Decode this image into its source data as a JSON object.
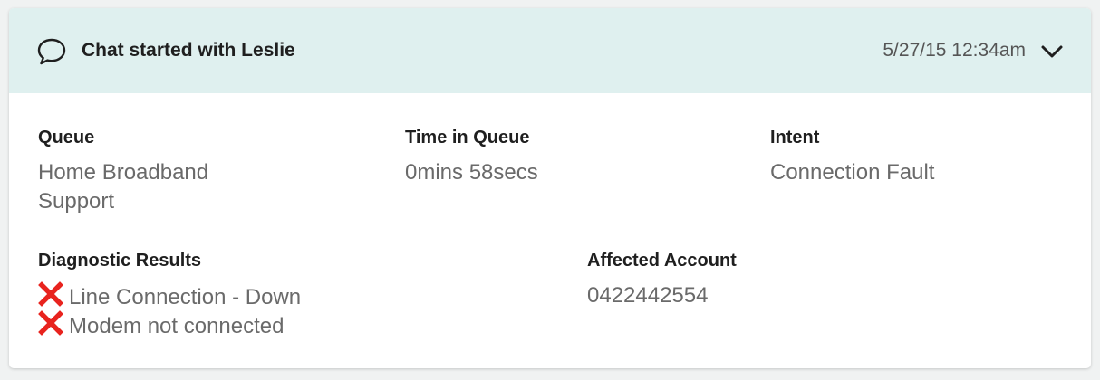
{
  "header": {
    "title": "Chat started with Leslie",
    "timestamp": "5/27/15 12:34am",
    "icon": "chat-bubble-icon",
    "expand_icon": "chevron-down-icon",
    "background_color": "#dff0ef"
  },
  "fields": {
    "queue": {
      "label": "Queue",
      "value": "Home Broadband Support"
    },
    "time_in_queue": {
      "label": "Time in Queue",
      "value": "0mins 58secs"
    },
    "intent": {
      "label": "Intent",
      "value": "Connection Fault"
    },
    "diagnostic_results": {
      "label": "Diagnostic Results",
      "items": [
        {
          "status": "failed",
          "icon": "red-x-icon",
          "text": "Line Connection - Down"
        },
        {
          "status": "failed",
          "icon": "red-x-icon",
          "text": "Modem not connected"
        }
      ]
    },
    "affected_account": {
      "label": "Affected Account",
      "value": "0422442554"
    }
  },
  "colors": {
    "error_red": "#e8231e",
    "label_text": "#1f1f1f",
    "value_text": "#6a6a6a"
  }
}
